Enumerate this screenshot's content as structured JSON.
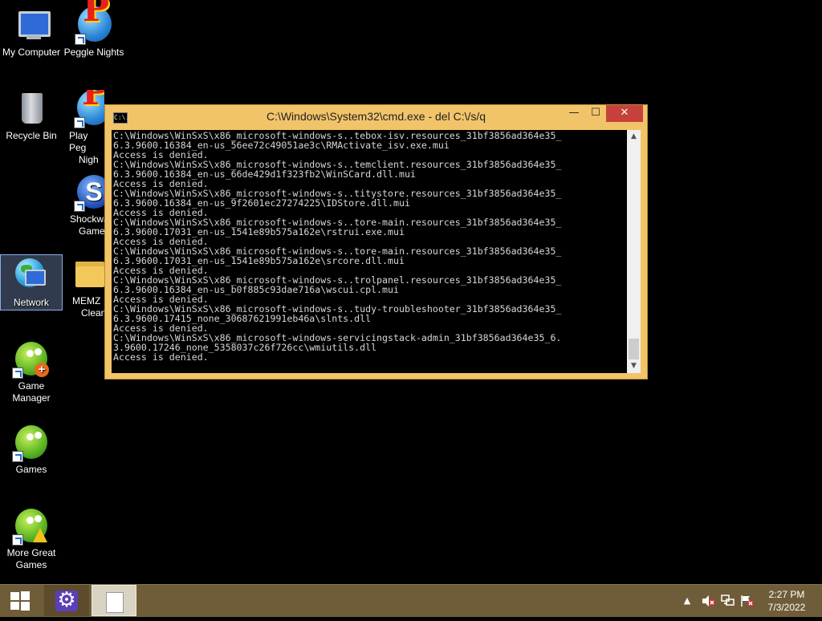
{
  "desktop": {
    "icons": [
      {
        "label": "My Computer",
        "icon": "computer-icon"
      },
      {
        "label": "Peggle Nights",
        "icon": "peggle-icon"
      },
      {
        "label": "Recycle Bin",
        "icon": "recycle-bin-icon"
      },
      {
        "label": "Play Peggle Nights",
        "icon": "peggle-icon"
      },
      {
        "label": "Shockwave Games",
        "icon": "shockwave-icon"
      },
      {
        "label": "Network",
        "icon": "network-icon"
      },
      {
        "label": "MEMZ Clean",
        "icon": "folder-icon"
      },
      {
        "label": "Game Manager",
        "icon": "game-manager-icon"
      },
      {
        "label": "Games",
        "icon": "games-icon"
      },
      {
        "label": "More Great Games",
        "icon": "more-games-icon"
      }
    ],
    "visible_labels": {
      "play_peggle_line1": "Play Peg",
      "play_peggle_line2": "Nigh",
      "shockwave_line1": "Shockwa",
      "shockwave_line2": "Game",
      "memz_line1": "MEMZ",
      "memz_line2": "Clean"
    },
    "selected": "Network"
  },
  "cmd_window": {
    "icon_text": "C:\\.",
    "title": "C:\\Windows\\System32\\cmd.exe - del  C:\\/s/q",
    "minimize": "—",
    "maximize": "☐",
    "close": "✕",
    "lines": [
      "C:\\Windows\\WinSxS\\x86_microsoft-windows-s..tebox-isv.resources_31bf3856ad364e35_",
      "6.3.9600.16384_en-us_56ee72c49051ae3c\\RMActivate_isv.exe.mui",
      "Access is denied.",
      "C:\\Windows\\WinSxS\\x86_microsoft-windows-s..temclient.resources_31bf3856ad364e35_",
      "6.3.9600.16384_en-us_66de429d1f323fb2\\WinSCard.dll.mui",
      "Access is denied.",
      "C:\\Windows\\WinSxS\\x86_microsoft-windows-s..titystore.resources_31bf3856ad364e35_",
      "6.3.9600.16384_en-us_9f2601ec27274225\\IDStore.dll.mui",
      "Access is denied.",
      "C:\\Windows\\WinSxS\\x86_microsoft-windows-s..tore-main.resources_31bf3856ad364e35_",
      "6.3.9600.17031_en-us_1541e89b575a162e\\rstrui.exe.mui",
      "Access is denied.",
      "C:\\Windows\\WinSxS\\x86_microsoft-windows-s..tore-main.resources_31bf3856ad364e35_",
      "6.3.9600.17031_en-us_1541e89b575a162e\\srcore.dll.mui",
      "Access is denied.",
      "C:\\Windows\\WinSxS\\x86_microsoft-windows-s..trolpanel.resources_31bf3856ad364e35_",
      "6.3.9600.16384_en-us_b0f885c93dae716a\\wscui.cpl.mui",
      "Access is denied.",
      "C:\\Windows\\WinSxS\\x86_microsoft-windows-s..tudy-troubleshooter_31bf3856ad364e35_",
      "6.3.9600.17415_none_30687621991eb46a\\slnts.dll",
      "Access is denied.",
      "C:\\Windows\\WinSxS\\x86_microsoft-windows-servicingstack-admin_31bf3856ad364e35_6.",
      "3.9600.17246_none_5358037c26f726cc\\wmiutils.dll",
      "Access is denied."
    ]
  },
  "taskbar": {
    "tray_arrow": "▲",
    "clock_time": "2:27 PM",
    "clock_date": "7/3/2022"
  }
}
